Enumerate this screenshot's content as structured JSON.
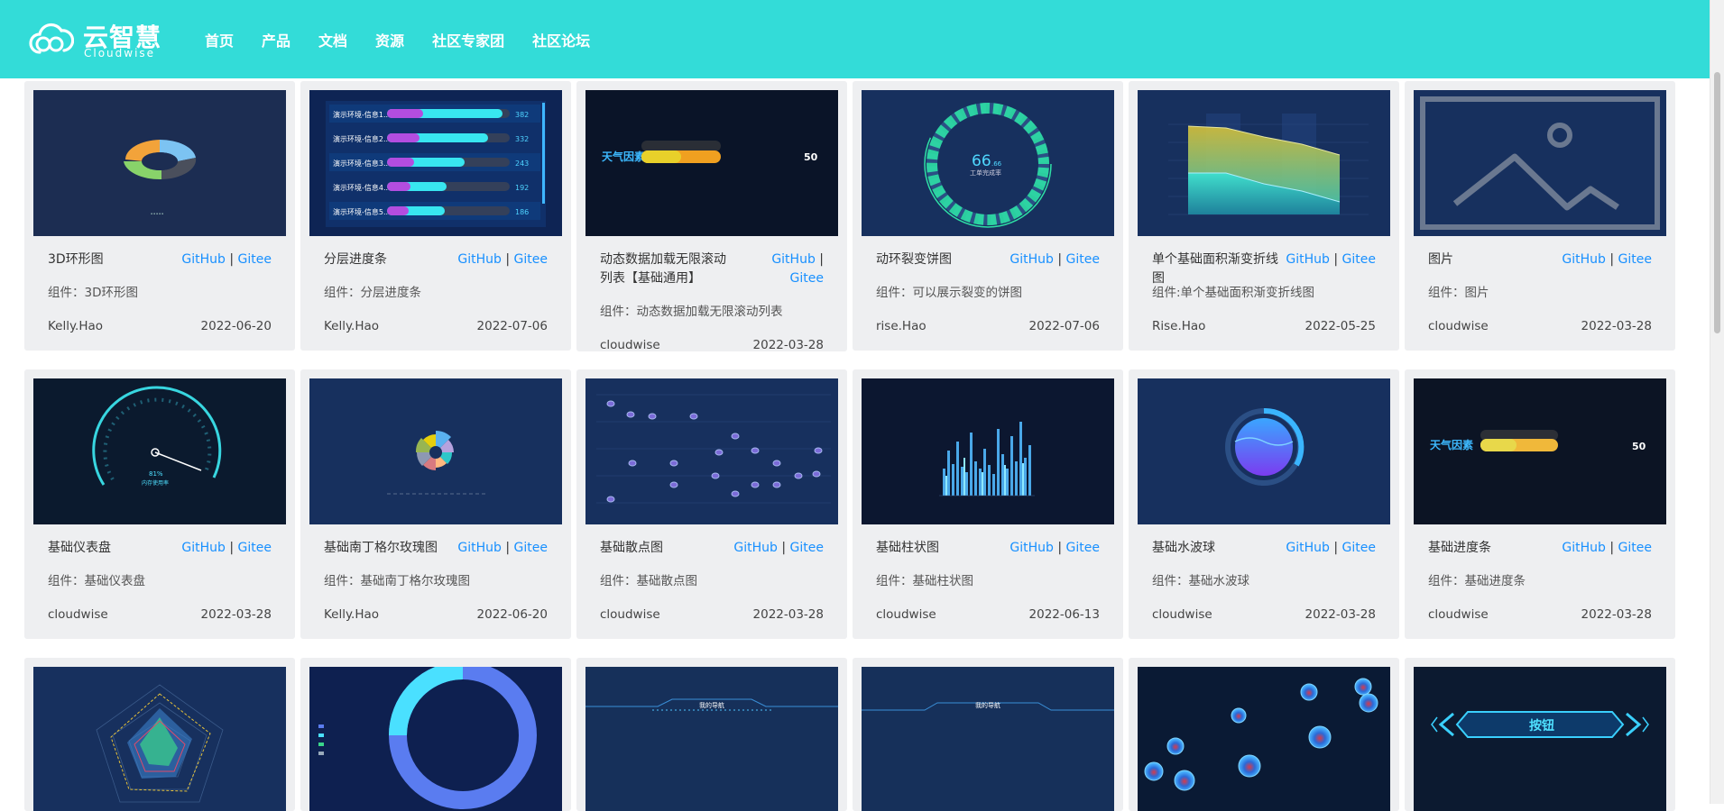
{
  "brand": {
    "name_cn": "云智慧",
    "name_en": "Cloudwise"
  },
  "nav": [
    "首页",
    "产品",
    "文档",
    "资源",
    "社区专家团",
    "社区论坛"
  ],
  "link_labels": {
    "github": "GitHub",
    "sep": "|",
    "gitee": "Gitee"
  },
  "colors": {
    "header": "#33dcd8",
    "link": "#1890ff",
    "card": "#eeeff1"
  },
  "cards": [
    {
      "title": "3D环形图",
      "desc": "组件：3D环形图",
      "author": "Kelly.Hao",
      "date": "2022-06-20",
      "thumb": "3d-ring-chart"
    },
    {
      "title": "分层进度条",
      "desc": "组件：分层进度条",
      "author": "Kelly.Hao",
      "date": "2022-07-06",
      "thumb": "layered-progress-bars",
      "thumb_text": {
        "rows": [
          "演示环境-信息1...",
          "演示环境-信息2...",
          "演示环境-信息3...",
          "演示环境-信息4...",
          "演示环境-信息5..."
        ],
        "values": [
          "382",
          "332",
          "243",
          "192",
          "186"
        ]
      }
    },
    {
      "title": "动态数据加载无限滚动列表【基础通用】",
      "desc": "组件：动态数据加载无限滚动列表",
      "author": "cloudwise",
      "date": "2022-03-28",
      "thumb": "weather-progress-bar",
      "thumb_text": {
        "label": "天气因素",
        "value": "50"
      }
    },
    {
      "title": "动环裂变饼图",
      "desc": "组件：可以展示裂变的饼图",
      "author": "rise.Hao",
      "date": "2022-07-06",
      "thumb": "segmented-ring-gauge",
      "thumb_text": {
        "value": "66",
        "unit": ".66",
        "label": "工单完成率"
      }
    },
    {
      "title": "单个基础面积渐变折线图",
      "desc": "组件:单个基础面积渐变折线图",
      "author": "Rise.Hao",
      "date": "2022-05-25",
      "thumb": "gradient-area-line-chart"
    },
    {
      "title": "图片",
      "desc": "组件：图片",
      "author": "cloudwise",
      "date": "2022-03-28",
      "thumb": "image-placeholder"
    },
    {
      "title": "基础仪表盘",
      "desc": "组件：基础仪表盘",
      "author": "cloudwise",
      "date": "2022-03-28",
      "thumb": "basic-gauge",
      "thumb_text": {
        "value": "81%",
        "label": "内存使用率"
      }
    },
    {
      "title": "基础南丁格尔玫瑰图",
      "desc": "组件：基础南丁格尔玫瑰图",
      "author": "Kelly.Hao",
      "date": "2022-06-20",
      "thumb": "nightingale-rose-chart"
    },
    {
      "title": "基础散点图",
      "desc": "组件：基础散点图",
      "author": "cloudwise",
      "date": "2022-03-28",
      "thumb": "scatter-chart"
    },
    {
      "title": "基础柱状图",
      "desc": "组件：基础柱状图",
      "author": "cloudwise",
      "date": "2022-06-13",
      "thumb": "bar-chart"
    },
    {
      "title": "基础水波球",
      "desc": "组件：基础水波球",
      "author": "cloudwise",
      "date": "2022-03-28",
      "thumb": "water-wave-ball"
    },
    {
      "title": "基础进度条",
      "desc": "组件：基础进度条",
      "author": "cloudwise",
      "date": "2022-03-28",
      "thumb": "basic-progress-bar",
      "thumb_text": {
        "label": "天气因素",
        "value": "50"
      }
    },
    {
      "thumb": "radar-chart"
    },
    {
      "thumb": "donut-legend-chart"
    },
    {
      "thumb": "nav-header-1",
      "thumb_text": {
        "label": "我的导航"
      }
    },
    {
      "thumb": "nav-header-2",
      "thumb_text": {
        "label": "我的导航"
      }
    },
    {
      "thumb": "floating-bubbles"
    },
    {
      "thumb": "tech-button",
      "thumb_text": {
        "label": "按钮"
      }
    }
  ]
}
